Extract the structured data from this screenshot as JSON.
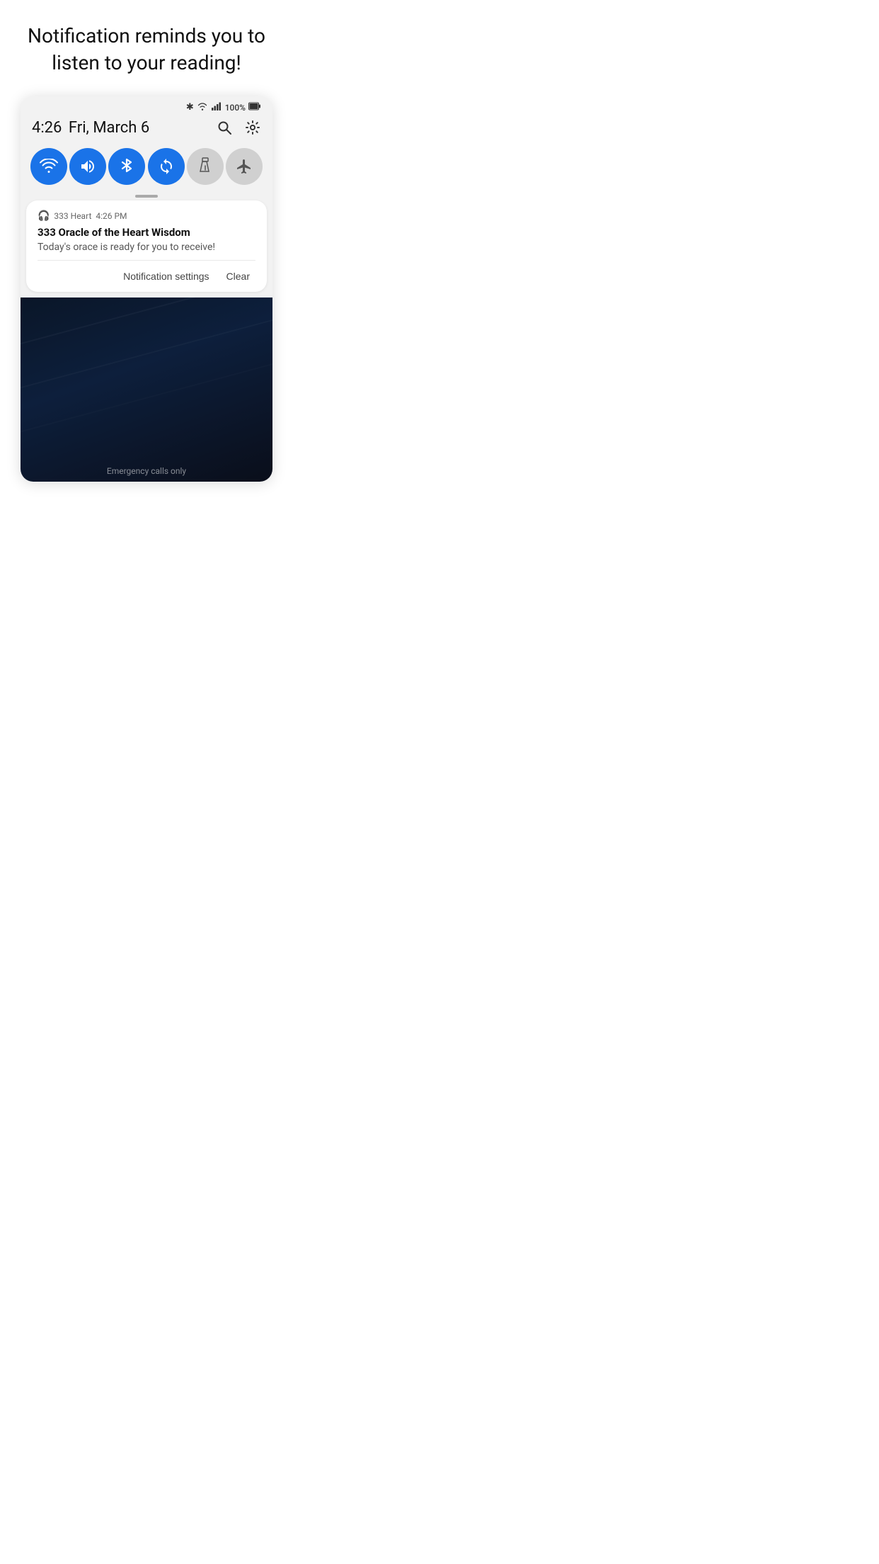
{
  "headline": "Notification reminds you to\nlisten to your reading!",
  "status_bar": {
    "time": "4:26",
    "date": "Fri, March 6",
    "battery": "100%",
    "icons": {
      "bluetooth": "✱",
      "wifi": "▲",
      "signal": "▌",
      "battery_icon": "🔋"
    }
  },
  "quick_settings": {
    "search_label": "Search",
    "settings_label": "Settings"
  },
  "toggles": [
    {
      "id": "wifi",
      "icon": "wifi",
      "active": true
    },
    {
      "id": "sound",
      "icon": "sound",
      "active": true
    },
    {
      "id": "bluetooth",
      "icon": "bluetooth",
      "active": true
    },
    {
      "id": "sync",
      "icon": "sync",
      "active": true
    },
    {
      "id": "flashlight",
      "icon": "flashlight",
      "active": false
    },
    {
      "id": "airplane",
      "icon": "airplane",
      "active": false
    }
  ],
  "notification": {
    "app_name": "333 Heart",
    "time": "4:26 PM",
    "title": "333 Oracle of the Heart Wisdom",
    "body": "Today's orace is ready for you to receive!",
    "actions": {
      "settings": "Notification settings",
      "clear": "Clear"
    }
  },
  "emergency": "Emergency calls only"
}
